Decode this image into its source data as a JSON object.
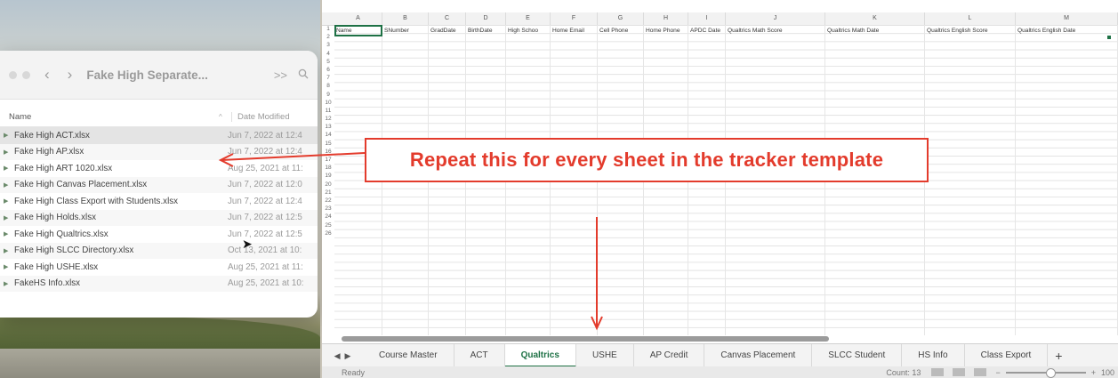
{
  "finder": {
    "title": "Fake High Separate...",
    "back_icon": "chevron-left",
    "forward_icon": "chevron-right",
    "more_icon": ">>",
    "search_icon": "magnifier",
    "columns": {
      "name": "Name",
      "date": "Date Modified"
    },
    "files": [
      {
        "name": "Fake High ACT.xlsx",
        "date": "Jun 7, 2022 at 12:4"
      },
      {
        "name": "Fake High AP.xlsx",
        "date": "Jun 7, 2022 at 12:4"
      },
      {
        "name": "Fake High ART 1020.xlsx",
        "date": "Aug 25, 2021 at 11:"
      },
      {
        "name": "Fake High Canvas Placement.xlsx",
        "date": "Jun 7, 2022 at 12:0"
      },
      {
        "name": "Fake High Class Export with Students.xlsx",
        "date": "Jun 7, 2022 at 12:4"
      },
      {
        "name": "Fake High Holds.xlsx",
        "date": "Jun 7, 2022 at 12:5"
      },
      {
        "name": "Fake High Qualtrics.xlsx",
        "date": "Jun 7, 2022 at 12:5"
      },
      {
        "name": "Fake High SLCC Directory.xlsx",
        "date": "Oct 13, 2021 at 10:"
      },
      {
        "name": "Fake High USHE.xlsx",
        "date": "Aug 25, 2021 at 11:"
      },
      {
        "name": "FakeHS Info.xlsx",
        "date": "Aug 25, 2021 at 10:"
      }
    ]
  },
  "excel": {
    "columns": [
      "A",
      "B",
      "C",
      "D",
      "E",
      "F",
      "G",
      "H",
      "I",
      "J",
      "K",
      "L",
      "M"
    ],
    "header_cells": [
      "Name",
      "SNumber",
      "GradDate",
      "BirthDate",
      "High Schoo",
      "Home Email",
      "Cell Phone",
      "Home Phone",
      "APDC Date",
      "Qualtrics Math Score",
      "Qualtrics Math Date",
      "Qualtrics English Score",
      "Qualtrics English Date"
    ],
    "row_numbers": [
      "1",
      "2",
      "3",
      "4",
      "5",
      "6",
      "7",
      "8",
      "9",
      "10",
      "11",
      "12",
      "13",
      "14",
      "15",
      "16",
      "17",
      "18",
      "19",
      "20",
      "21",
      "22",
      "23",
      "24",
      "25",
      "26"
    ],
    "tabs": [
      "Course Master",
      "ACT",
      "Qualtrics",
      "USHE",
      "AP Credit",
      "Canvas Placement",
      "SLCC Student",
      "HS Info",
      "Class Export"
    ],
    "active_tab": "Qualtrics",
    "tab_prev": "◀",
    "tab_next": "▶",
    "add_sheet": "+",
    "status": {
      "ready": "Ready",
      "count": "Count: 13",
      "zoom_minus": "−",
      "zoom_plus": "+",
      "zoom": "100",
      "zoom_fraction": 0.55
    },
    "accent_color": "#1e7145"
  },
  "annotation": {
    "callout_text": "Repeat this for every sheet in the tracker template",
    "color": "#e33b2c"
  }
}
